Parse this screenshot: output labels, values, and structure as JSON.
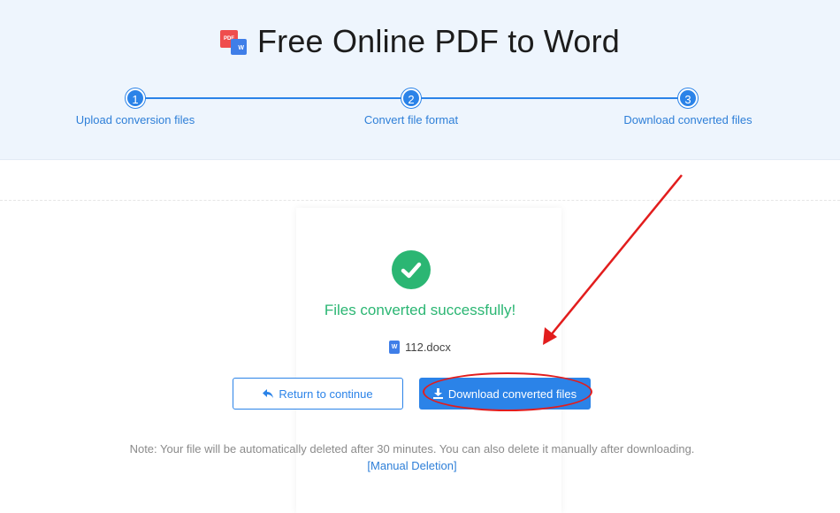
{
  "header": {
    "title": "Free Online PDF to Word",
    "logo_icon": "pdf-to-word-icon",
    "logo_pdf_text": "PDF",
    "logo_w_text": "W"
  },
  "steps": [
    {
      "number": "1",
      "label": "Upload conversion files"
    },
    {
      "number": "2",
      "label": "Convert file format"
    },
    {
      "number": "3",
      "label": "Download converted files"
    }
  ],
  "result": {
    "success_icon": "checkmark-icon",
    "success_text": "Files converted successfully!",
    "file_icon": "word-file-icon",
    "file_icon_text": "W",
    "file_name": "112.docx"
  },
  "actions": {
    "return_label": "Return to continue",
    "return_icon": "reply-arrow-icon",
    "download_label": "Download converted files",
    "download_icon": "download-icon"
  },
  "note": {
    "text": "Note: Your file will be automatically deleted after 30 minutes. You can also delete it manually after downloading.",
    "manual_link": "[Manual Deletion]"
  },
  "colors": {
    "accent": "#2b83e8",
    "success": "#2bb673",
    "annotation": "#e21d1d",
    "header_bg": "#eef5fd"
  }
}
